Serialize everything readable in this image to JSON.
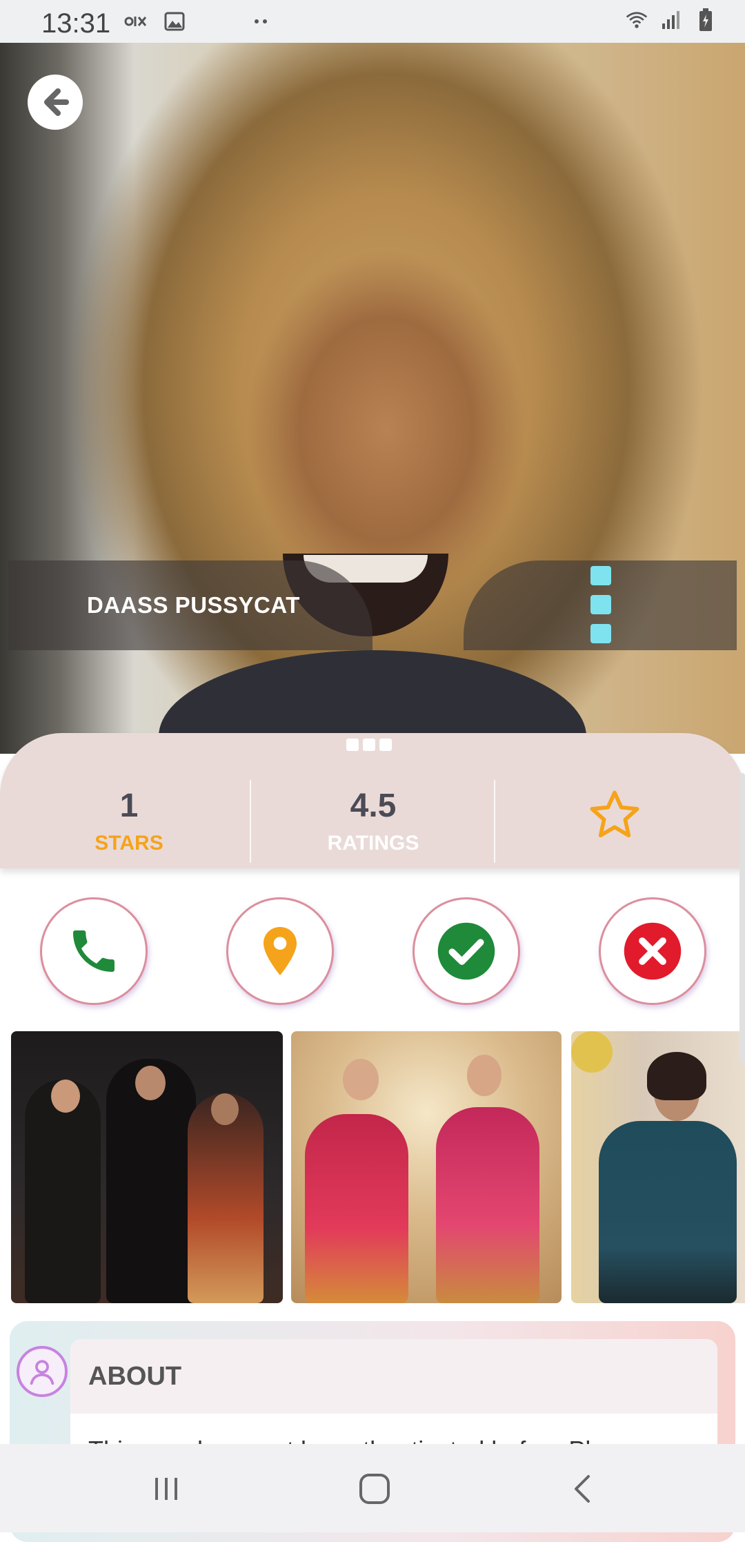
{
  "status_bar": {
    "time": "13:31",
    "left_icons": [
      "olx-icon",
      "image-icon",
      "dots-icon"
    ],
    "right_icons": [
      "wifi-icon",
      "signal-icon",
      "battery-icon"
    ]
  },
  "profile": {
    "name": "DAASS PUSSYCAT"
  },
  "stats": [
    {
      "value": "1",
      "label": "STARS",
      "label_color": "#f5a31a"
    },
    {
      "value": "4.5",
      "label": "RATINGS",
      "label_color": "#ffffff"
    }
  ],
  "colors": {
    "accent_cyan": "#7ee3ef",
    "call_green": "#1f8a3a",
    "location_orange": "#f5a31a",
    "accept_green": "#1f8a3a",
    "reject_red": "#e11b2c",
    "star_orange": "#f5a31a"
  },
  "actions": [
    "phone-icon",
    "location-pin-icon",
    "check-icon",
    "close-icon"
  ],
  "gallery": {
    "count_visible": 3
  },
  "about": {
    "title": "ABOUT",
    "body": "This member must be authenticated before Pl..."
  },
  "nav": [
    "recent-apps-icon",
    "home-icon",
    "back-icon"
  ]
}
